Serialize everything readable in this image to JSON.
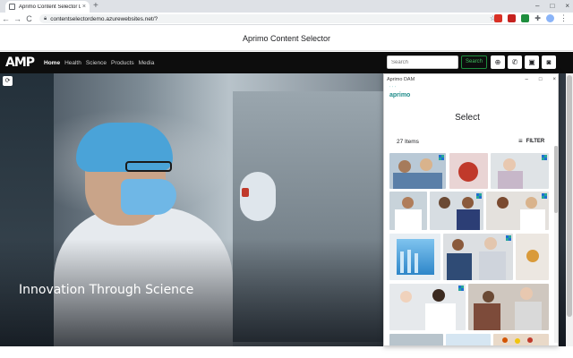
{
  "browser": {
    "tab_title": "Aprimo Content Selector Demo",
    "tab_close": "×",
    "new_tab": "+",
    "window_controls": [
      "–",
      "□",
      "×"
    ],
    "nav": {
      "back": "←",
      "forward": "→",
      "reload": "C"
    },
    "url": "contentselectordemo.azurewebsites.net/?",
    "icons": [
      "lock-icon",
      "star-icon",
      "puzzle-icon",
      "profile-icon",
      "menu-icon"
    ]
  },
  "page_header": {
    "title": "Aprimo Content Selector"
  },
  "site_nav": {
    "logo": "AMP",
    "links": [
      "Home",
      "Health",
      "Science",
      "Products",
      "Media"
    ],
    "active": "Home",
    "search_placeholder": "Search",
    "search_button": "Search",
    "icon_buttons": [
      "globe-icon",
      "phone-icon",
      "image-icon",
      "portrait-icon"
    ]
  },
  "hero": {
    "caption": "Innovation Through Science"
  },
  "dam": {
    "window_title": "Aprimo DAM",
    "window_controls": [
      "–",
      "□",
      "×"
    ],
    "logo_text": "aprimo",
    "logo_mark": "˙˙˙",
    "heading": "Select",
    "item_count": "27 Items",
    "filter_label": "FILTER",
    "filter_icon": "≡",
    "thumbnail_badge_colors": [
      "#1f6fd1",
      "#26a69a"
    ]
  },
  "colors": {
    "nav_background": "#0d0d0d",
    "search_button_border": "#1e8e3e",
    "brand_teal": "#1f8c8a"
  }
}
